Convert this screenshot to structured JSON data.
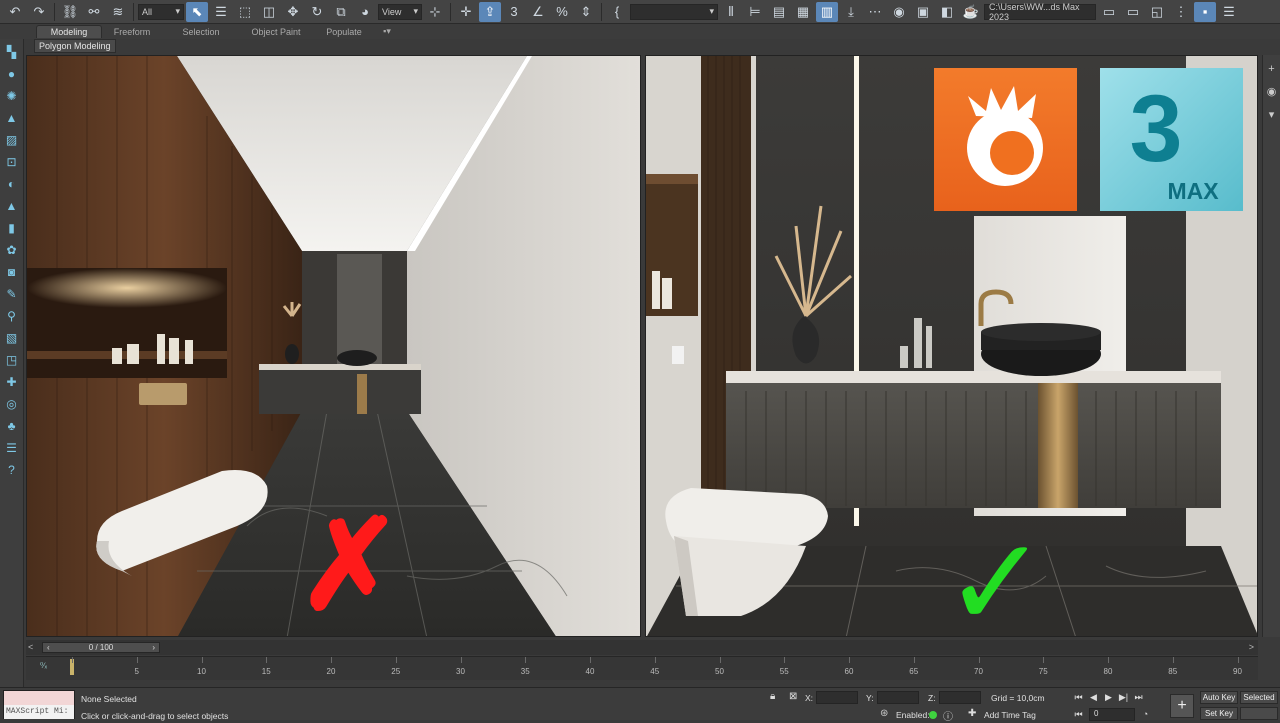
{
  "toolbar": {
    "selection_filter": "All",
    "view_dropdown": "View",
    "project_path": "C:\\Users\\WW...ds Max 2023"
  },
  "ribbon": {
    "tabs": [
      "Modeling",
      "Freeform",
      "Selection",
      "Object Paint",
      "Populate"
    ],
    "active_tab": "Modeling",
    "subpanel": "Polygon Modeling"
  },
  "viewports": {
    "left_mark": "✗",
    "right_mark": "✓",
    "left_mark_color": "#ff1a1a",
    "right_mark_color": "#22dd22",
    "corona_logo_color": "#f26a21",
    "max_logo_text": "MAX",
    "max_logo_number": "3"
  },
  "timeline": {
    "frame_counter": "0 / 100",
    "ticks": [
      0,
      5,
      10,
      15,
      20,
      25,
      30,
      35,
      40,
      45,
      50,
      55,
      60,
      65,
      70,
      75,
      80,
      85,
      90
    ],
    "tick_labels": [
      "5",
      "10",
      "15",
      "20",
      "25",
      "30",
      "35",
      "40",
      "45",
      "50",
      "55",
      "60",
      "65",
      "70",
      "75",
      "80",
      "85",
      "90"
    ]
  },
  "status": {
    "maxscript_label": "MAXScript Mi:",
    "selection_status": "None Selected",
    "prompt": "Click or click-and-drag to select objects",
    "x_label": "X:",
    "y_label": "Y:",
    "z_label": "Z:",
    "grid": "Grid = 10,0cm",
    "enabled_label": "Enabled:",
    "add_time_tag": "Add Time Tag",
    "auto_key": "Auto Key",
    "set_key": "Set Key",
    "selected_dropdown": "Selected",
    "frame_value": "0"
  }
}
